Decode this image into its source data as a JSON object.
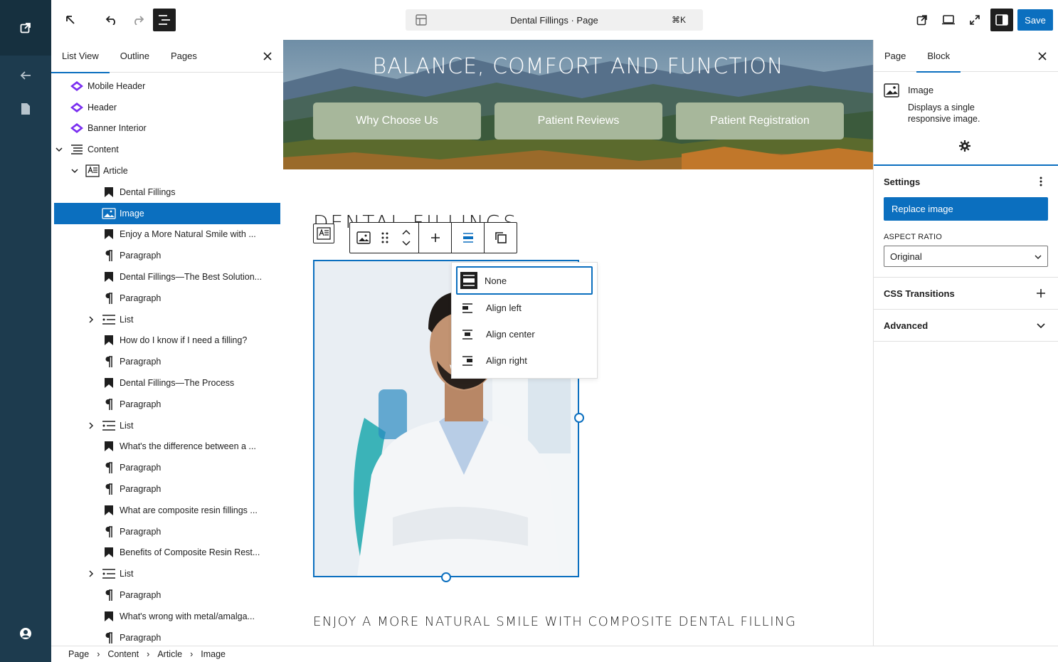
{
  "topbar": {
    "command_title": "Dental Fillings · Page",
    "command_shortcut": "⌘K",
    "save_label": "Save"
  },
  "listview": {
    "tabs": [
      {
        "label": "List View"
      },
      {
        "label": "Outline"
      },
      {
        "label": "Pages"
      }
    ],
    "items": [
      {
        "label": "Mobile Header"
      },
      {
        "label": "Header"
      },
      {
        "label": "Banner Interior"
      },
      {
        "label": "Content"
      },
      {
        "label": "Article"
      },
      {
        "label": "Dental Fillings"
      },
      {
        "label": "Image"
      },
      {
        "label": "Enjoy a More Natural Smile with ..."
      },
      {
        "label": "Paragraph"
      },
      {
        "label": "Dental Fillings—The Best Solution..."
      },
      {
        "label": "Paragraph"
      },
      {
        "label": "List"
      },
      {
        "label": "How do I know if I need a filling?"
      },
      {
        "label": "Paragraph"
      },
      {
        "label": "Dental Fillings—The Process"
      },
      {
        "label": "Paragraph"
      },
      {
        "label": "List"
      },
      {
        "label": "What's the difference between a ..."
      },
      {
        "label": "Paragraph"
      },
      {
        "label": "Paragraph"
      },
      {
        "label": "What are composite resin fillings ..."
      },
      {
        "label": "Paragraph"
      },
      {
        "label": "Benefits of Composite Resin Rest..."
      },
      {
        "label": "List"
      },
      {
        "label": "Paragraph"
      },
      {
        "label": "What's wrong with metal/amalga..."
      },
      {
        "label": "Paragraph"
      }
    ]
  },
  "canvas": {
    "banner_title": "BALANCE, COMFORT AND FUNCTION",
    "buttons": [
      {
        "label": "Why Choose Us"
      },
      {
        "label": "Patient Reviews"
      },
      {
        "label": "Patient Registration"
      }
    ],
    "page_heading": "DENTAL FILLINGS",
    "sub_heading": "ENJOY A MORE NATURAL SMILE WITH COMPOSITE DENTAL FILLING",
    "align_menu": [
      {
        "label": "None"
      },
      {
        "label": "Align left"
      },
      {
        "label": "Align center"
      },
      {
        "label": "Align right"
      }
    ]
  },
  "sidebar": {
    "tabs": [
      {
        "label": "Page"
      },
      {
        "label": "Block"
      }
    ],
    "block_name": "Image",
    "block_desc": "Displays a single responsive image.",
    "settings_title": "Settings",
    "replace_label": "Replace image",
    "aspect_label": "ASPECT RATIO",
    "aspect_value": "Original",
    "css_transitions": "CSS Transitions",
    "advanced": "Advanced"
  },
  "breadcrumb": [
    "Page",
    "Content",
    "Article",
    "Image"
  ],
  "colors": {
    "accent": "#0b6fbf",
    "rail": "#1d3b4e",
    "pill": "#a7b79b",
    "pattern_icon": "#7a2ef0"
  }
}
